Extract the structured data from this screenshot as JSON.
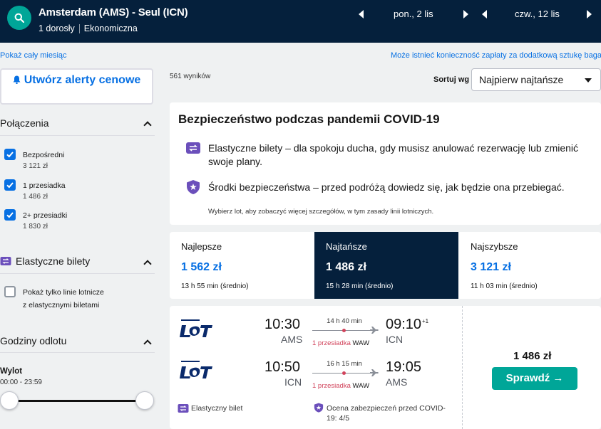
{
  "header": {
    "route": "Amsterdam (AMS) - Seul (ICN)",
    "passengers": "1 dorosły",
    "cabin": "Ekonomiczna",
    "depart_date": "pon., 2 lis",
    "return_date": "czw., 12 lis"
  },
  "links": {
    "show_month": "Pokaż cały miesiąc",
    "baggage_note": "Może istnieć konieczność zapłaty za dodatkową sztukę bagażu"
  },
  "sidebar": {
    "alert_button": "Utwórz alerty cenowe",
    "connections": {
      "title": "Połączenia",
      "items": [
        {
          "label": "Bezpośredni",
          "price": "3 121 zł",
          "checked": true
        },
        {
          "label": "1 przesiadka",
          "price": "1 486 zł",
          "checked": true
        },
        {
          "label": "2+ przesiadki",
          "price": "1 830 zł",
          "checked": true
        }
      ]
    },
    "flexible": {
      "title": "Elastyczne bilety",
      "option_line1": "Pokaż tylko linie lotnicze",
      "option_line2": "z elastycznymi biletami"
    },
    "times": {
      "title": "Godziny odlotu",
      "sub": "Wylot",
      "range": "00:00 - 23:59"
    }
  },
  "main": {
    "results_count": "561 wyników",
    "sort_label": "Sortuj wg",
    "sort_value": "Najpierw najtańsze",
    "covid": {
      "title": "Bezpieczeństwo podczas pandemii COVID-19",
      "line1": "Elastyczne bilety – dla spokoju ducha, gdy musisz anulować rezerwację lub zmienić swoje plany.",
      "line2": "Środki bezpieczeństwa – przed podróżą dowiedz się, jak będzie ona przebiegać.",
      "note": "Wybierz lot, aby zobaczyć więcej szczegółów, w tym zasady linii lotniczych."
    },
    "tabs": [
      {
        "name": "Najlepsze",
        "price": "1 562 zł",
        "duration": "13 h 55 min (średnio)",
        "active": false
      },
      {
        "name": "Najtańsze",
        "price": "1 486 zł",
        "duration": "15 h 28 min (średnio)",
        "active": true
      },
      {
        "name": "Najszybsze",
        "price": "3 121 zł",
        "duration": "11 h 03 min (średnio)",
        "active": false
      }
    ],
    "result": {
      "airline": "LOT",
      "outbound": {
        "dep_time": "10:30",
        "dep_code": "AMS",
        "duration": "14 h 40 min",
        "stops": "1 przesiadka",
        "via": "WAW",
        "arr_time": "09:10",
        "arr_code": "ICN",
        "day_offset": "+1"
      },
      "inbound": {
        "dep_time": "10:50",
        "dep_code": "ICN",
        "duration": "16 h 15 min",
        "stops": "1 przesiadka",
        "via": "WAW",
        "arr_time": "19:05",
        "arr_code": "AMS"
      },
      "price": "1 486 zł",
      "button": "Sprawdź →",
      "flex_tag": "Elastyczny bilet",
      "safety_tag": "Ocena zabezpieczeń przed COVID-19: 4/5"
    }
  },
  "colors": {
    "navy": "#05203c",
    "teal": "#00a698",
    "blue": "#0770e3",
    "stop_red": "#d1435b",
    "flex_purple": "#6b4fbb"
  }
}
